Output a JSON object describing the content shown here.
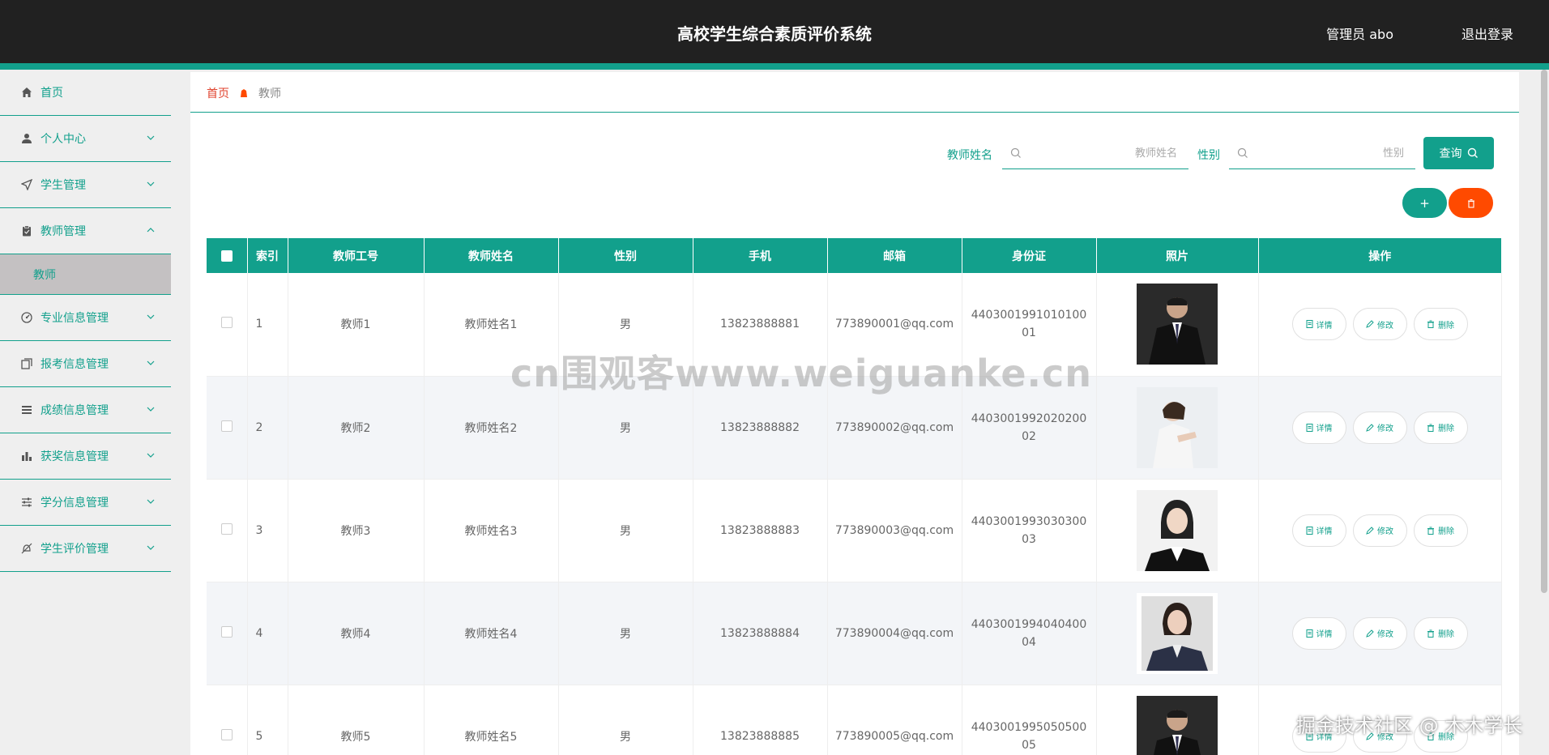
{
  "header": {
    "title": "高校学生综合素质评价系统",
    "admin": "管理员 abo",
    "logout": "退出登录"
  },
  "sidebar": {
    "items": [
      {
        "label": "首页",
        "icon": "home-icon"
      },
      {
        "label": "个人中心",
        "icon": "user-icon"
      },
      {
        "label": "学生管理",
        "icon": "send-icon"
      },
      {
        "label": "教师管理",
        "icon": "clipboard-icon",
        "expanded": true
      },
      {
        "label": "专业信息管理",
        "icon": "gauge-icon"
      },
      {
        "label": "报考信息管理",
        "icon": "copy-icon"
      },
      {
        "label": "成绩信息管理",
        "icon": "list-icon"
      },
      {
        "label": "获奖信息管理",
        "icon": "bar-chart-icon"
      },
      {
        "label": "学分信息管理",
        "icon": "sliders-icon"
      },
      {
        "label": "学生评价管理",
        "icon": "bell-off-icon"
      }
    ],
    "submenu": {
      "label": "教师"
    }
  },
  "breadcrumb": {
    "home": "首页",
    "current": "教师"
  },
  "search": {
    "name_label": "教师姓名",
    "name_placeholder": "教师姓名",
    "name_value": "",
    "gender_label": "性别",
    "gender_placeholder": "性别",
    "gender_value": "",
    "query_label": "查询"
  },
  "actions": {
    "add_label": "+"
  },
  "table": {
    "headers": [
      "索引",
      "教师工号",
      "教师姓名",
      "性别",
      "手机",
      "邮箱",
      "身份证",
      "照片",
      "操作"
    ],
    "op_labels": {
      "detail": "详情",
      "edit": "修改",
      "delete": "删除"
    },
    "rows": [
      {
        "index": "1",
        "id": "教师1",
        "name": "教师姓名1",
        "gender": "男",
        "phone": "13823888881",
        "email": "773890001@qq.com",
        "idcard": "440300199101010001"
      },
      {
        "index": "2",
        "id": "教师2",
        "name": "教师姓名2",
        "gender": "男",
        "phone": "13823888882",
        "email": "773890002@qq.com",
        "idcard": "440300199202020002"
      },
      {
        "index": "3",
        "id": "教师3",
        "name": "教师姓名3",
        "gender": "男",
        "phone": "13823888883",
        "email": "773890003@qq.com",
        "idcard": "440300199303030003"
      },
      {
        "index": "4",
        "id": "教师4",
        "name": "教师姓名4",
        "gender": "男",
        "phone": "13823888884",
        "email": "773890004@qq.com",
        "idcard": "440300199404040004"
      },
      {
        "index": "5",
        "id": "教师5",
        "name": "教师姓名5",
        "gender": "男",
        "phone": "13823888885",
        "email": "773890005@qq.com",
        "idcard": "440300199505050005"
      }
    ]
  },
  "watermarks": {
    "center": "cn围观客www.weiguanke.cn",
    "corner": "掘金技术社区 @ 木木学长"
  },
  "colors": {
    "accent": "#12a08c",
    "header_bg": "#212121",
    "danger": "#ff4a00",
    "breadcrumb_home": "#e0422d"
  }
}
